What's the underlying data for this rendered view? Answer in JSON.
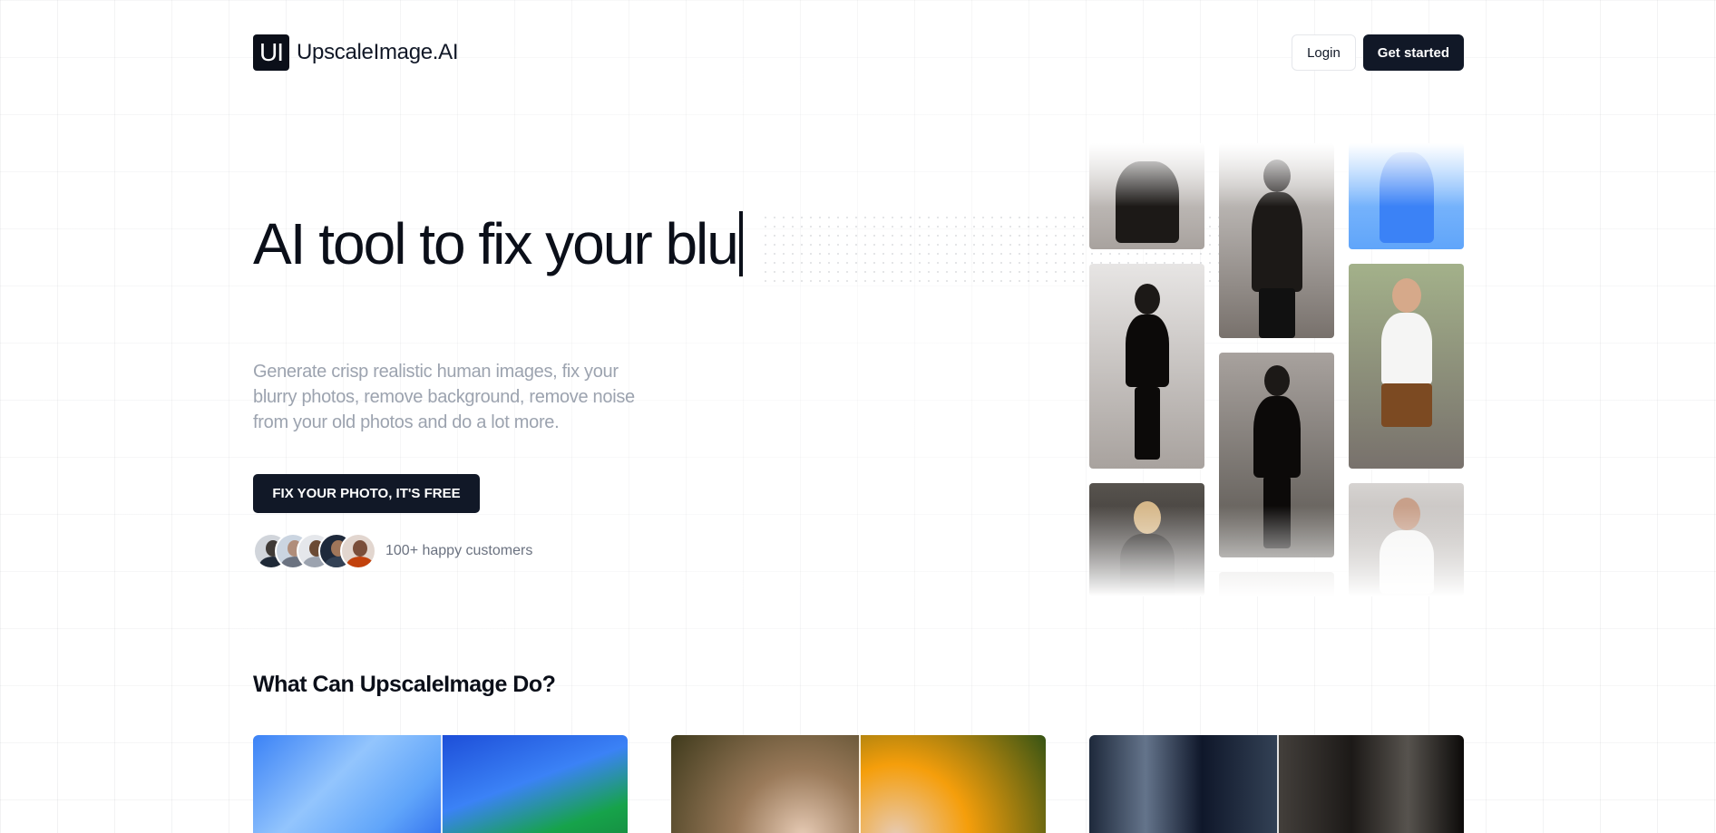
{
  "logo": {
    "mark": "UI",
    "name": "UpscaleImage.AI"
  },
  "nav": {
    "login_label": "Login",
    "start_label": "Get started"
  },
  "hero": {
    "title": "AI tool to fix your blu",
    "subtitle": "Generate crisp realistic human images, fix your blurry photos, remove background, remove noise from your old photos and do a lot more.",
    "cta_label": "FIX YOUR PHOTO, IT'S FREE",
    "customers_text": "100+ happy customers"
  },
  "section": {
    "title": "What Can UpscaleImage Do?"
  },
  "colors": {
    "primary": "#111827",
    "muted_text": "#9ca3af",
    "background": "#ffffff"
  }
}
